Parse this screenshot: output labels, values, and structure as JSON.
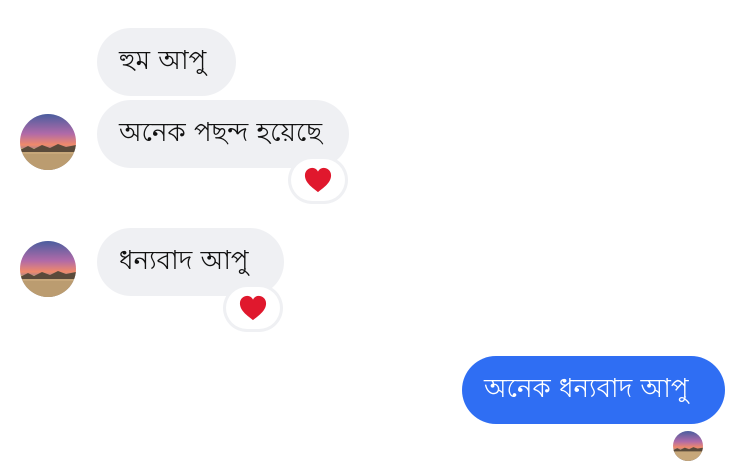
{
  "messages": [
    {
      "text": "হুম আপু",
      "direction": "incoming"
    },
    {
      "text": "অনেক পছন্দ হয়েছে",
      "direction": "incoming",
      "reaction": "heart-icon"
    },
    {
      "text": "ধন্যবাদ আপু",
      "direction": "incoming",
      "reaction": "heart-icon"
    },
    {
      "text": "অনেক ধন্যবাদ আপু",
      "direction": "outgoing"
    }
  ],
  "colors": {
    "incoming_bubble": "#eff0f3",
    "outgoing_bubble": "#2f6ef3",
    "heart": "#e0182d"
  },
  "icons": {
    "reaction": "heart-icon",
    "read_receipt": "avatar-read-receipt"
  }
}
